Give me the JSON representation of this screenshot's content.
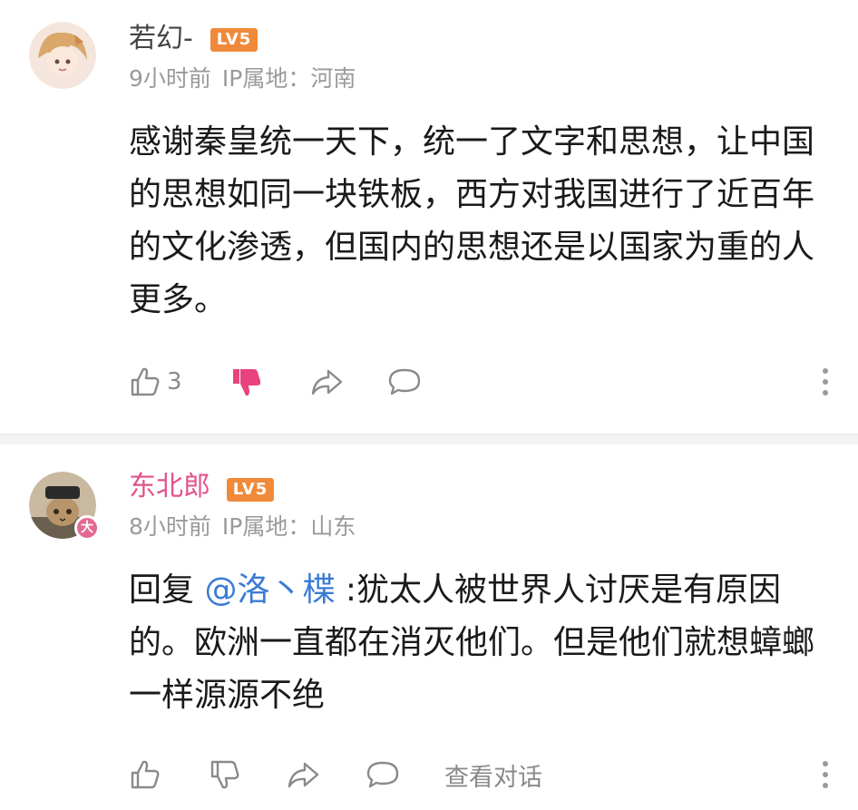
{
  "comments": [
    {
      "username": "若幻-",
      "level": "LV5",
      "time": "9小时前",
      "ip_label": "IP属地：",
      "ip_location": "河南",
      "text": "感谢秦皇统一天下，统一了文字和思想，让中国的思想如同一块铁板，西方对我国进行了近百年的文化渗透，但国内的思想还是以国家为重的人更多。",
      "like_count": "3",
      "disliked": true
    },
    {
      "username": "东北郎",
      "level": "LV5",
      "time": "8小时前",
      "ip_label": "IP属地：",
      "ip_location": "山东",
      "badge": "大",
      "reply_prefix": "回复 ",
      "mention": "@洛丶楪",
      "text": " :犹太人被世界人讨厌是有原因的。欧洲一直都在消灭他们。但是他们就想蟑螂一样源源不绝",
      "view_conversation": "查看对话"
    }
  ],
  "colors": {
    "username_vip": "#e0548a",
    "level_badge": "#f08a3a",
    "dislike_active": "#e8437e",
    "mention": "#3a7bd5",
    "meta": "#9a9a9a"
  },
  "icons": [
    "thumbs-up-icon",
    "thumbs-down-icon",
    "share-icon",
    "comment-icon",
    "more-icon"
  ]
}
